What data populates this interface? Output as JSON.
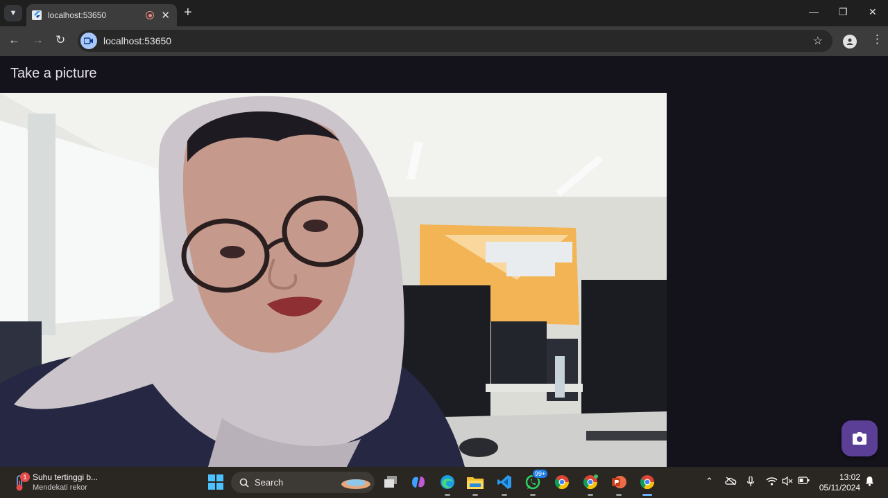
{
  "browser": {
    "tab_title": "localhost:53650",
    "url": "localhost:53650"
  },
  "page": {
    "title": "Take a picture"
  },
  "icons": {
    "tab_search": "chevron-down-icon",
    "favicon": "flutter-icon",
    "recording": "recording-icon",
    "close": "close-icon",
    "new_tab": "plus-icon",
    "back": "back-arrow-icon",
    "forward": "forward-arrow-icon",
    "reload": "reload-icon",
    "site_info": "camera-in-use-icon",
    "bookmark": "star-icon",
    "profile": "profile-icon",
    "menu": "more-vert-icon",
    "capture": "camera-icon"
  },
  "taskbar": {
    "weather_badge": "1",
    "weather_line1": "Suhu tertinggi b...",
    "weather_line2": "Mendekati rekor",
    "search_label": "Search",
    "whatsapp_badge": "99+",
    "time": "13:02",
    "date": "05/11/2024"
  },
  "colors": {
    "page_background": "#14121a",
    "fab_background": "#5b3e96",
    "taskbar_background": "#2a2622"
  }
}
